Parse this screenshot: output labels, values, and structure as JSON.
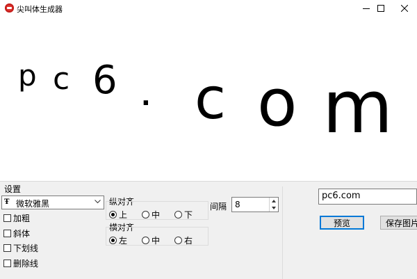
{
  "window": {
    "title": "尖叫体生成器"
  },
  "preview": {
    "glyphs": [
      {
        "char": "p"
      },
      {
        "char": "c"
      },
      {
        "char": "6"
      },
      {
        "char": "."
      },
      {
        "char": "c"
      },
      {
        "char": "o"
      },
      {
        "char": "m"
      }
    ]
  },
  "settings": {
    "group_label": "设置",
    "font_select": {
      "value": "微软雅黑",
      "icon": "font-icon"
    },
    "checkboxes": [
      {
        "label": "加粗",
        "checked": false
      },
      {
        "label": "斜体",
        "checked": false
      },
      {
        "label": "下划线",
        "checked": false
      },
      {
        "label": "删除线",
        "checked": false
      }
    ],
    "vertical_align": {
      "label": "纵对齐",
      "options": [
        {
          "label": "上",
          "selected": true
        },
        {
          "label": "中",
          "selected": false
        },
        {
          "label": "下",
          "selected": false
        }
      ]
    },
    "horizontal_align": {
      "label": "横对齐",
      "options": [
        {
          "label": "左",
          "selected": true
        },
        {
          "label": "中",
          "selected": false
        },
        {
          "label": "右",
          "selected": false
        }
      ]
    },
    "spacing": {
      "label": "间隔",
      "value": "8"
    }
  },
  "right_panel": {
    "text_value": "pc6.com",
    "preview_button": "预览",
    "save_button": "保存图片"
  }
}
